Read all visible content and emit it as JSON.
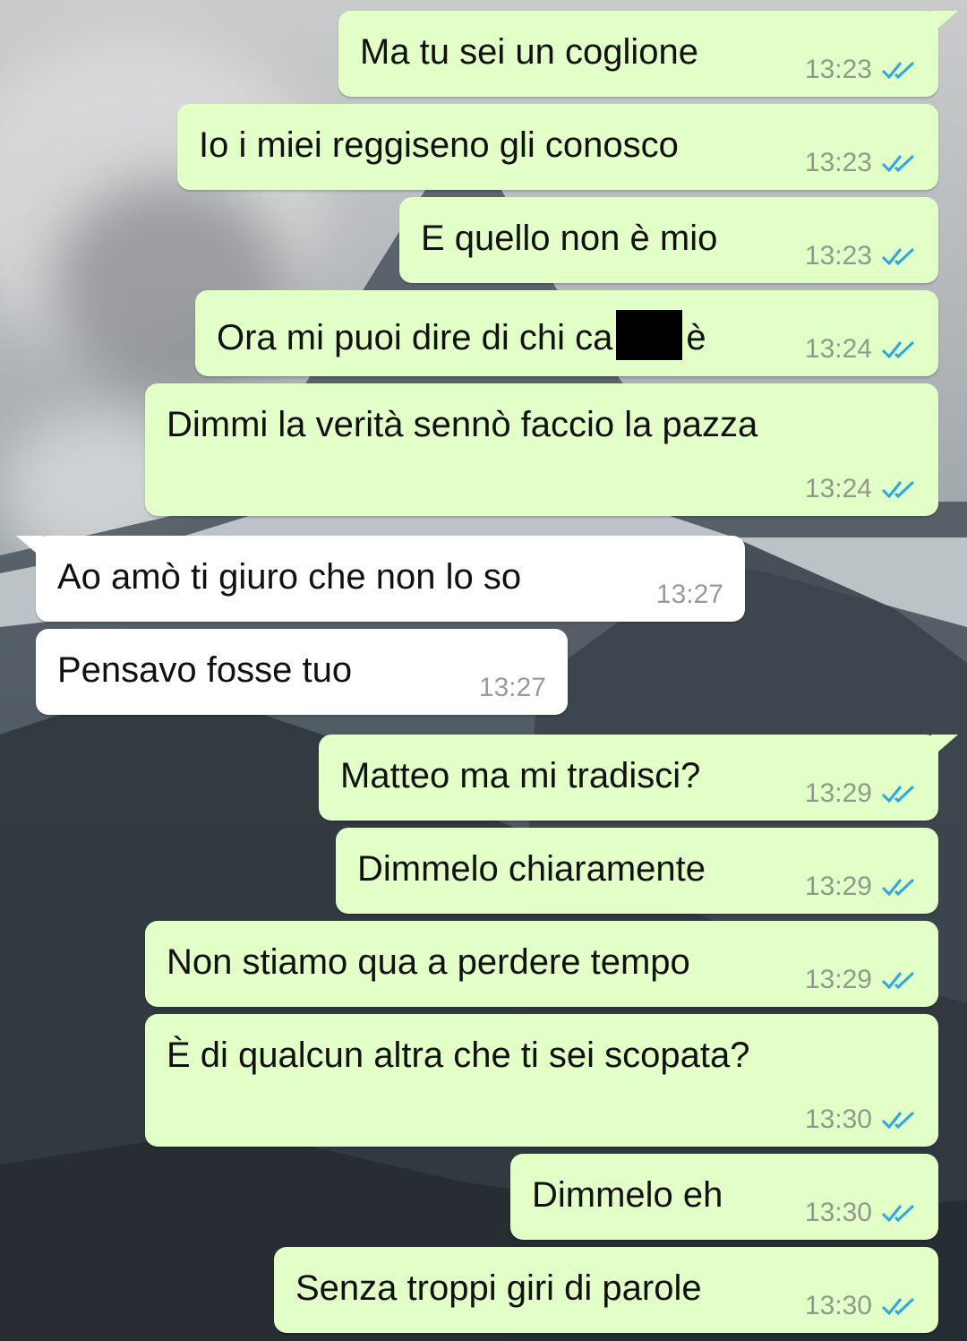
{
  "chat": {
    "messages": [
      {
        "text": "Ma tu sei un coglione",
        "time": "13:23"
      },
      {
        "text": "Io i miei reggiseno gli conosco",
        "time": "13:23"
      },
      {
        "text": "E quello non è mio",
        "time": "13:23"
      },
      {
        "text_before": "Ora mi puoi dire di chi ca",
        "text_after": "è",
        "time": "13:24"
      },
      {
        "text": "Dimmi la verità sennò faccio la pazza",
        "time": "13:24"
      },
      {
        "text": "Ao amò ti giuro che non lo so",
        "time": "13:27"
      },
      {
        "text": "Pensavo fosse tuo",
        "time": "13:27"
      },
      {
        "text": "Matteo ma mi tradisci?",
        "time": "13:29"
      },
      {
        "text": "Dimmelo chiaramente",
        "time": "13:29"
      },
      {
        "text": "Non stiamo qua a perdere tempo",
        "time": "13:29"
      },
      {
        "text": "È di qualcun altra che ti sei scopata?",
        "time": "13:30"
      },
      {
        "text": "Dimmelo eh",
        "time": "13:30"
      },
      {
        "text": "Senza troppi giri di parole",
        "time": "13:30"
      }
    ]
  },
  "colors": {
    "outgoing_bubble": "#e2ffc7",
    "incoming_bubble": "#ffffff",
    "read_ticks": "#2aa7e6"
  },
  "icons": {
    "read_receipt": "double-check-icon"
  }
}
